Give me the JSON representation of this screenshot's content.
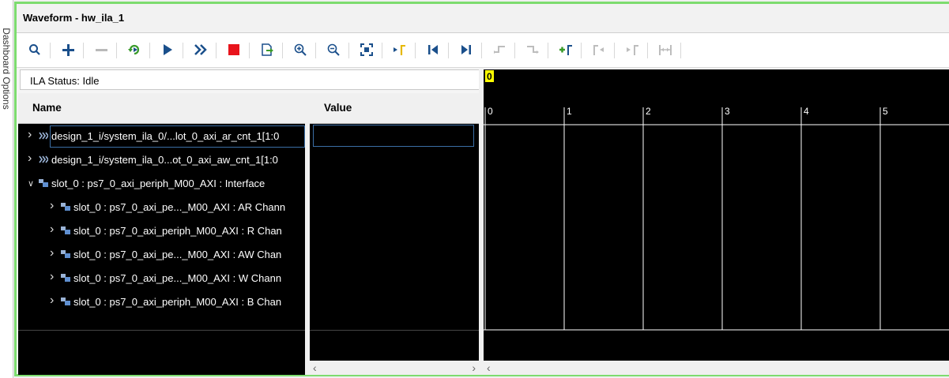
{
  "side_tab": {
    "label": "Dashboard Options"
  },
  "window": {
    "title": "Waveform - hw_ila_1"
  },
  "toolbar": {
    "buttons": [
      {
        "name": "search",
        "enabled": true
      },
      {
        "name": "add",
        "enabled": true
      },
      {
        "name": "remove",
        "enabled": false
      },
      {
        "name": "auto-retrigger",
        "enabled": true
      },
      {
        "name": "run-trigger",
        "enabled": true
      },
      {
        "name": "run-trigger-immediate",
        "enabled": true
      },
      {
        "name": "stop-trigger",
        "enabled": true
      },
      {
        "name": "export",
        "enabled": true
      },
      {
        "name": "zoom-in",
        "enabled": true
      },
      {
        "name": "zoom-out",
        "enabled": true
      },
      {
        "name": "zoom-fit",
        "enabled": true
      },
      {
        "name": "go-to-cursor",
        "enabled": true
      },
      {
        "name": "go-to-time-0",
        "enabled": true
      },
      {
        "name": "go-to-last-time",
        "enabled": true
      },
      {
        "name": "previous-transition",
        "enabled": false
      },
      {
        "name": "next-transition",
        "enabled": false
      },
      {
        "name": "add-marker",
        "enabled": true
      },
      {
        "name": "previous-marker",
        "enabled": false
      },
      {
        "name": "next-marker",
        "enabled": false
      },
      {
        "name": "swap-cursors",
        "enabled": false
      }
    ]
  },
  "status": {
    "text": "ILA Status: Idle"
  },
  "columns": {
    "name": "Name",
    "value": "Value"
  },
  "rows": [
    {
      "label": "design_1_i/system_ila_0/...lot_0_axi_ar_cnt_1[1:0",
      "expanded": false,
      "indent": 0,
      "icon": "bus"
    },
    {
      "label": "design_1_i/system_ila_0...ot_0_axi_aw_cnt_1[1:0",
      "expanded": false,
      "indent": 0,
      "icon": "bus"
    },
    {
      "label": "slot_0 : ps7_0_axi_periph_M00_AXI : Interface",
      "expanded": true,
      "indent": 0,
      "icon": "interface"
    },
    {
      "label": "slot_0 : ps7_0_axi_pe..._M00_AXI : AR Chann",
      "expanded": false,
      "indent": 1,
      "icon": "interface"
    },
    {
      "label": "slot_0 : ps7_0_axi_periph_M00_AXI : R Chan",
      "expanded": false,
      "indent": 1,
      "icon": "interface"
    },
    {
      "label": "slot_0 : ps7_0_axi_pe..._M00_AXI : AW Chan",
      "expanded": false,
      "indent": 1,
      "icon": "interface"
    },
    {
      "label": "slot_0 : ps7_0_axi_pe..._M00_AXI : W Chann",
      "expanded": false,
      "indent": 1,
      "icon": "interface"
    },
    {
      "label": "slot_0 : ps7_0_axi_periph_M00_AXI : B Chan",
      "expanded": false,
      "indent": 1,
      "icon": "interface"
    }
  ],
  "waveform": {
    "cursor_label": "0",
    "ticks": [
      "0",
      "1",
      "2",
      "3",
      "4",
      "5"
    ]
  }
}
